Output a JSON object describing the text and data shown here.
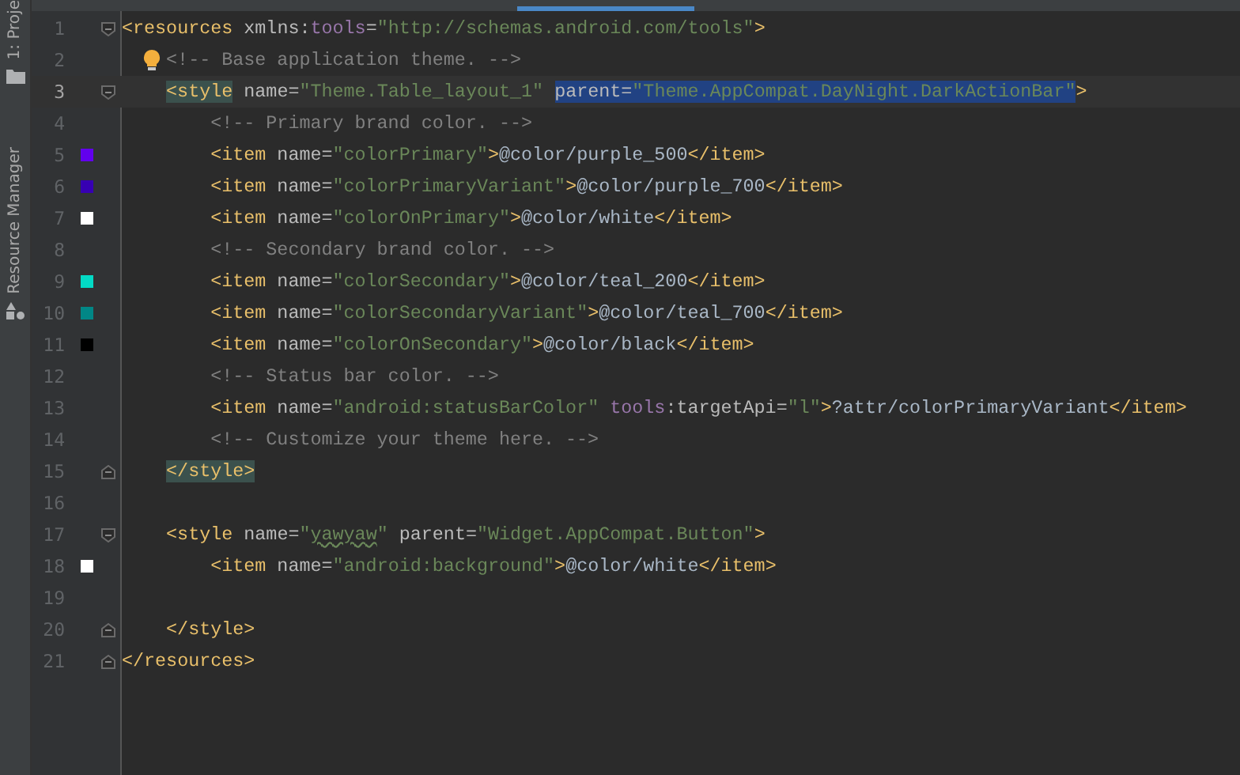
{
  "tool_strip": [
    {
      "label": "1: Proje"
    },
    {
      "label": "Resource Manager"
    }
  ],
  "editor": {
    "lines": [
      {
        "number": "1",
        "fold_start": true,
        "tokens": [
          {
            "kind": "tag",
            "text": "<resources"
          },
          {
            "kind": "attr",
            "text": " xmlns:"
          },
          {
            "kind": "ns",
            "text": "tools"
          },
          {
            "kind": "attr",
            "text": "="
          },
          {
            "kind": "value",
            "text": "\"http://schemas.android.com/tools\""
          },
          {
            "kind": "tag",
            "text": ">"
          }
        ],
        "children": [
          {
            "number": "2",
            "bulb": true,
            "tokens": [
              {
                "kind": "comment",
                "text": "<!-- Base application theme. -->"
              }
            ]
          },
          {
            "number": "3",
            "fold_start": true,
            "current": true,
            "tokens": [
              {
                "kind": "tag",
                "text": "<style",
                "matched": true
              },
              {
                "kind": "attr",
                "text": " name="
              },
              {
                "kind": "value",
                "text": "\"Theme.Table_layout_1\" "
              },
              {
                "kind": "attr",
                "text": "parent=",
                "selected": true
              },
              {
                "kind": "value",
                "text": "\"Theme.AppCompat.DayNight.DarkActionBar\"",
                "selected": true
              },
              {
                "kind": "tag",
                "text": ">"
              }
            ],
            "children": [
              {
                "number": "4",
                "tokens": [
                  {
                    "kind": "comment",
                    "text": "<!-- Primary brand color. -->"
                  }
                ]
              },
              {
                "number": "5",
                "color": "#6200ee",
                "tokens": [
                  {
                    "kind": "tag",
                    "text": "<item"
                  },
                  {
                    "kind": "attr",
                    "text": " name="
                  },
                  {
                    "kind": "value",
                    "text": "\"colorPrimary\""
                  },
                  {
                    "kind": "tag",
                    "text": ">"
                  },
                  {
                    "kind": "text",
                    "text": "@color/purple_500"
                  },
                  {
                    "kind": "tag",
                    "text": "</item>"
                  }
                ]
              },
              {
                "number": "6",
                "color": "#3700b3",
                "tokens": [
                  {
                    "kind": "tag",
                    "text": "<item"
                  },
                  {
                    "kind": "attr",
                    "text": " name="
                  },
                  {
                    "kind": "value",
                    "text": "\"colorPrimaryVariant\""
                  },
                  {
                    "kind": "tag",
                    "text": ">"
                  },
                  {
                    "kind": "text",
                    "text": "@color/purple_700"
                  },
                  {
                    "kind": "tag",
                    "text": "</item>"
                  }
                ]
              },
              {
                "number": "7",
                "color": "#ffffff",
                "tokens": [
                  {
                    "kind": "tag",
                    "text": "<item"
                  },
                  {
                    "kind": "attr",
                    "text": " name="
                  },
                  {
                    "kind": "value",
                    "text": "\"colorOnPrimary\""
                  },
                  {
                    "kind": "tag",
                    "text": ">"
                  },
                  {
                    "kind": "text",
                    "text": "@color/white"
                  },
                  {
                    "kind": "tag",
                    "text": "</item>"
                  }
                ]
              },
              {
                "number": "8",
                "tokens": [
                  {
                    "kind": "comment",
                    "text": "<!-- Secondary brand color. -->"
                  }
                ]
              },
              {
                "number": "9",
                "color": "#03dac5",
                "tokens": [
                  {
                    "kind": "tag",
                    "text": "<item"
                  },
                  {
                    "kind": "attr",
                    "text": " name="
                  },
                  {
                    "kind": "value",
                    "text": "\"colorSecondary\""
                  },
                  {
                    "kind": "tag",
                    "text": ">"
                  },
                  {
                    "kind": "text",
                    "text": "@color/teal_200"
                  },
                  {
                    "kind": "tag",
                    "text": "</item>"
                  }
                ]
              },
              {
                "number": "10",
                "color": "#018786",
                "tokens": [
                  {
                    "kind": "tag",
                    "text": "<item"
                  },
                  {
                    "kind": "attr",
                    "text": " name="
                  },
                  {
                    "kind": "value",
                    "text": "\"colorSecondaryVariant\""
                  },
                  {
                    "kind": "tag",
                    "text": ">"
                  },
                  {
                    "kind": "text",
                    "text": "@color/teal_700"
                  },
                  {
                    "kind": "tag",
                    "text": "</item>"
                  }
                ]
              },
              {
                "number": "11",
                "color": "#000000",
                "tokens": [
                  {
                    "kind": "tag",
                    "text": "<item"
                  },
                  {
                    "kind": "attr",
                    "text": " name="
                  },
                  {
                    "kind": "value",
                    "text": "\"colorOnSecondary\""
                  },
                  {
                    "kind": "tag",
                    "text": ">"
                  },
                  {
                    "kind": "text",
                    "text": "@color/black"
                  },
                  {
                    "kind": "tag",
                    "text": "</item>"
                  }
                ]
              },
              {
                "number": "12",
                "tokens": [
                  {
                    "kind": "comment",
                    "text": "<!-- Status bar color. -->"
                  }
                ]
              },
              {
                "number": "13",
                "tokens": [
                  {
                    "kind": "tag",
                    "text": "<item"
                  },
                  {
                    "kind": "attr",
                    "text": " name="
                  },
                  {
                    "kind": "value",
                    "text": "\"android:statusBarColor\" "
                  },
                  {
                    "kind": "ns",
                    "text": "tools"
                  },
                  {
                    "kind": "attr",
                    "text": ":targetApi="
                  },
                  {
                    "kind": "value",
                    "text": "\"l\""
                  },
                  {
                    "kind": "tag",
                    "text": ">"
                  },
                  {
                    "kind": "text",
                    "text": "?attr/colorPrimaryVariant"
                  },
                  {
                    "kind": "tag",
                    "text": "</item>"
                  }
                ]
              },
              {
                "number": "14",
                "tokens": [
                  {
                    "kind": "comment",
                    "text": "<!-- Customize your theme here. -->"
                  }
                ]
              }
            ]
          },
          {
            "number": "15",
            "fold_end": true,
            "tokens": [
              {
                "kind": "tag",
                "text": "</style>",
                "matched": true
              }
            ]
          },
          {
            "number": "16"
          },
          {
            "number": "17",
            "fold_start": true,
            "tokens": [
              {
                "kind": "tag",
                "text": "<style"
              },
              {
                "kind": "attr",
                "text": " name="
              },
              {
                "kind": "value",
                "text": "\""
              },
              {
                "kind": "value",
                "text": "yawyaw",
                "typo": true
              },
              {
                "kind": "value",
                "text": "\""
              },
              {
                "kind": "attr",
                "text": " parent="
              },
              {
                "kind": "value",
                "text": "\"Widget.AppCompat.Button\""
              },
              {
                "kind": "tag",
                "text": ">"
              }
            ],
            "children": [
              {
                "number": "18",
                "color": "#ffffff",
                "tokens": [
                  {
                    "kind": "tag",
                    "text": "<item"
                  },
                  {
                    "kind": "attr",
                    "text": " name="
                  },
                  {
                    "kind": "value",
                    "text": "\"android:background\""
                  },
                  {
                    "kind": "tag",
                    "text": ">"
                  },
                  {
                    "kind": "text",
                    "text": "@color/white"
                  },
                  {
                    "kind": "tag",
                    "text": "</item>"
                  }
                ]
              },
              {
                "number": "19"
              }
            ]
          },
          {
            "number": "20",
            "fold_end": true,
            "tokens": [
              {
                "kind": "tag",
                "text": "</style>"
              }
            ]
          }
        ]
      },
      {
        "number": "21",
        "fold_end": true,
        "tokens": [
          {
            "kind": "tag",
            "text": "</resources>"
          }
        ]
      }
    ]
  }
}
